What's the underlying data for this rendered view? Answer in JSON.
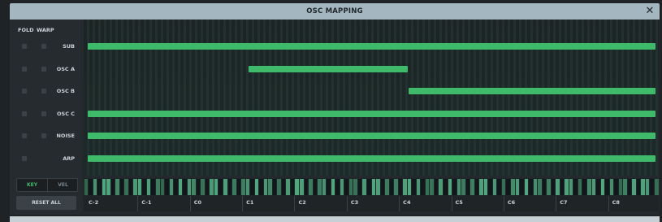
{
  "window": {
    "title": "OSC MAPPING",
    "close_glyph": "✕"
  },
  "headers": {
    "fold": "FOLD",
    "warp": "WARP"
  },
  "rows": [
    {
      "label": "SUB",
      "fold": true,
      "warp": true,
      "range": {
        "start": 0.0,
        "end": 1.0
      }
    },
    {
      "label": "OSC A",
      "fold": true,
      "warp": true,
      "range": {
        "start": 0.283,
        "end": 0.564
      }
    },
    {
      "label": "OSC B",
      "fold": true,
      "warp": true,
      "range": {
        "start": 0.565,
        "end": 1.0
      }
    },
    {
      "label": "OSC C",
      "fold": true,
      "warp": true,
      "range": {
        "start": 0.0,
        "end": 1.0
      }
    },
    {
      "label": "NOISE",
      "fold": true,
      "warp": true,
      "range": {
        "start": 0.0,
        "end": 1.0
      }
    },
    {
      "label": "ARP",
      "fold": true,
      "warp": false,
      "range": {
        "start": 0.0,
        "end": 1.0
      }
    }
  ],
  "mode": {
    "key": "KEY",
    "vel": "VEL",
    "selected": "KEY"
  },
  "reset_label": "RESET ALL",
  "octaves": [
    "C-2",
    "C-1",
    "C0",
    "C1",
    "C2",
    "C3",
    "C4",
    "C5",
    "C6",
    "C7",
    "C8"
  ],
  "colors": {
    "accent": "#3fba6b",
    "title_bar": "#a4b6bf"
  }
}
